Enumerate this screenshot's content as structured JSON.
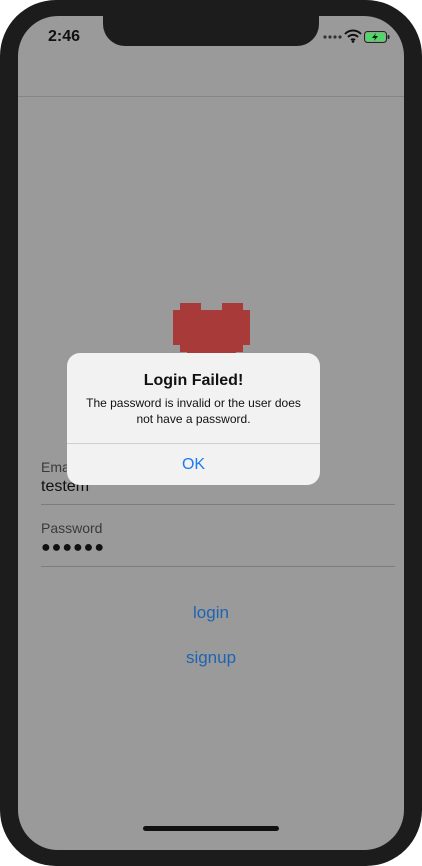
{
  "status_bar": {
    "time": "2:46"
  },
  "form": {
    "email_label": "Email",
    "email_value": "testem",
    "password_label": "Password",
    "password_value": "●●●●●●"
  },
  "buttons": {
    "login_label": "login",
    "signup_label": "signup"
  },
  "alert": {
    "title": "Login Failed!",
    "message": "The password is invalid or the user does not have a password.",
    "ok_label": "OK"
  },
  "icons": {
    "logo": "pixel-heart-icon",
    "signal": "cellular-dots-icon",
    "wifi": "wifi-icon",
    "battery": "battery-charging-icon"
  },
  "colors": {
    "heart": "#a83a3a",
    "link": "#1f64b0",
    "alert_button": "#1a7cf0",
    "battery_fill": "#4cd964"
  }
}
